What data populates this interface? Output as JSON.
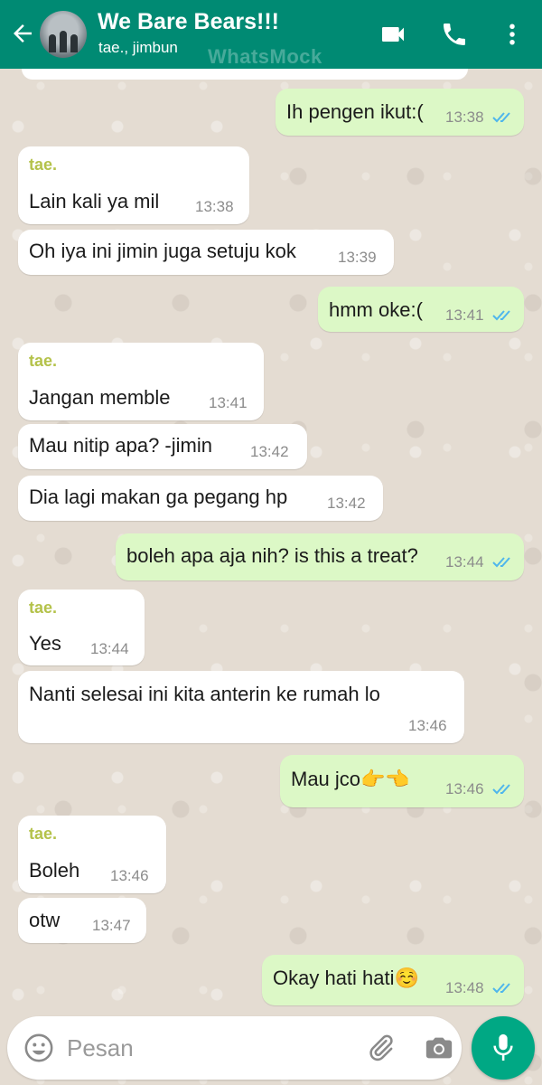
{
  "header": {
    "title": "We Bare Bears!!!",
    "subtitle": "tae., jimbun",
    "watermark": "WhatsMock",
    "icons": [
      "back-arrow-icon",
      "video-call-icon",
      "phone-call-icon",
      "more-vert-icon"
    ]
  },
  "messages": [
    {
      "dir": "out",
      "text": "Ih pengen ikut:(",
      "time": "13:38",
      "ticks": "double-blue"
    },
    {
      "dir": "in",
      "sender": "tae.",
      "text": "Lain kali ya mil",
      "time": "13:38"
    },
    {
      "dir": "in",
      "text": "Oh iya ini jimin juga setuju kok",
      "time": "13:39"
    },
    {
      "dir": "out",
      "text": "hmm oke:(",
      "time": "13:41",
      "ticks": "double-blue"
    },
    {
      "dir": "in",
      "sender": "tae.",
      "text": "Jangan memble",
      "time": "13:41"
    },
    {
      "dir": "in",
      "text": "Mau nitip apa? -jimin",
      "time": "13:42"
    },
    {
      "dir": "in",
      "text": "Dia lagi makan ga pegang hp",
      "time": "13:42"
    },
    {
      "dir": "out",
      "text": "boleh apa aja nih? is this a treat?",
      "time": "13:44",
      "ticks": "double-blue"
    },
    {
      "dir": "in",
      "sender": "tae.",
      "text": "Yes",
      "time": "13:44"
    },
    {
      "dir": "in",
      "text": "Nanti selesai ini kita anterin ke rumah lo",
      "time": "13:46"
    },
    {
      "dir": "out",
      "text": "Mau jco👉👈",
      "time": "13:46",
      "ticks": "double-blue"
    },
    {
      "dir": "in",
      "sender": "tae.",
      "text": "Boleh",
      "time": "13:46"
    },
    {
      "dir": "in",
      "text": "otw",
      "time": "13:47"
    },
    {
      "dir": "out",
      "text": "Okay hati hati☺️",
      "time": "13:48",
      "ticks": "double-blue"
    }
  ],
  "input": {
    "placeholder": "Pesan",
    "icons": [
      "emoji-icon",
      "attach-icon",
      "camera-icon",
      "mic-icon"
    ]
  },
  "colors": {
    "header": "#008a73",
    "outgoing_bubble": "#dcf8c6",
    "incoming_bubble": "#ffffff",
    "sender_name": "#b4c24a",
    "read_ticks": "#4fb6ec",
    "mic_button": "#00a884"
  }
}
